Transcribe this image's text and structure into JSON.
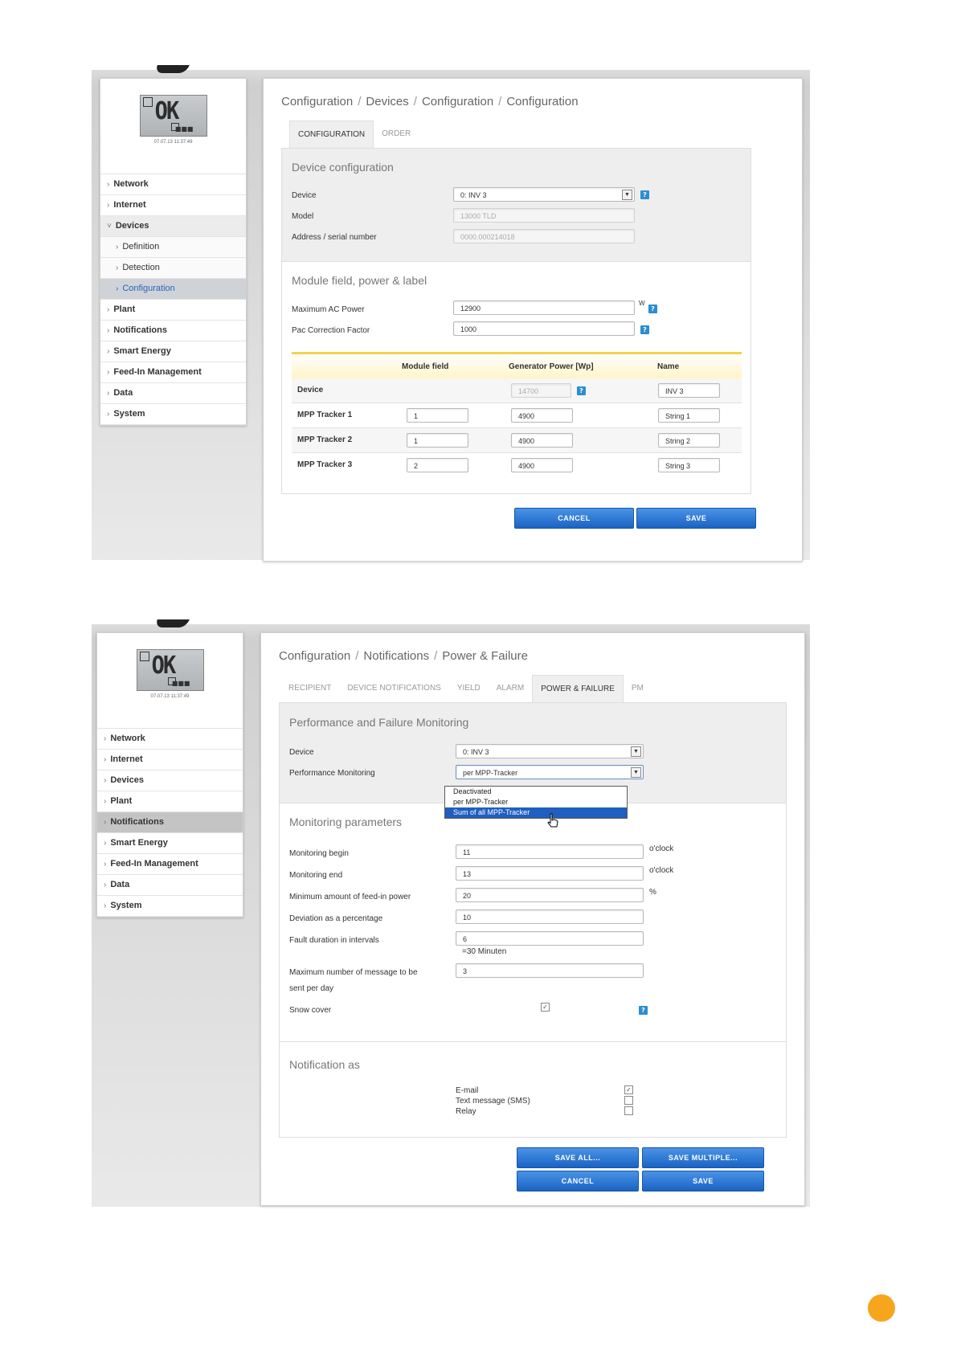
{
  "shot1": {
    "lcd": {
      "text": "OK",
      "time": "07.07.13 11:37:49"
    },
    "sidebar": [
      {
        "label": "Network",
        "type": "item"
      },
      {
        "label": "Internet",
        "type": "item"
      },
      {
        "label": "Devices",
        "type": "open"
      },
      {
        "label": "Definition",
        "type": "sub"
      },
      {
        "label": "Detection",
        "type": "sub"
      },
      {
        "label": "Configuration",
        "type": "sub-active"
      },
      {
        "label": "Plant",
        "type": "item"
      },
      {
        "label": "Notifications",
        "type": "item"
      },
      {
        "label": "Smart Energy",
        "type": "item"
      },
      {
        "label": "Feed-In Management",
        "type": "item"
      },
      {
        "label": "Data",
        "type": "item"
      },
      {
        "label": "System",
        "type": "item"
      }
    ],
    "breadcrumb": [
      "Configuration",
      "Devices",
      "Configuration",
      "Configuration"
    ],
    "tabs": [
      {
        "label": "CONFIGURATION",
        "active": true
      },
      {
        "label": "ORDER",
        "active": false
      }
    ],
    "device_config": {
      "title": "Device configuration",
      "device_label": "Device",
      "device_value": "0: INV 3",
      "model_label": "Model",
      "model_value": "13000 TLD",
      "address_label": "Address / serial number",
      "address_value": "0000.000214018"
    },
    "module": {
      "title": "Module field, power & label",
      "max_ac_label": "Maximum AC Power",
      "max_ac_value": "12900",
      "max_ac_unit": "W",
      "pac_label": "Pac Correction Factor",
      "pac_value": "1000",
      "headers": [
        "Module field",
        "Generator Power [Wp]",
        "Name"
      ],
      "rows": [
        {
          "label": "Device",
          "field": "",
          "power": "14700",
          "name": "INV 3"
        },
        {
          "label": "MPP Tracker 1",
          "field": "1",
          "power": "4900",
          "name": "String 1"
        },
        {
          "label": "MPP Tracker 2",
          "field": "1",
          "power": "4900",
          "name": "String 2"
        },
        {
          "label": "MPP Tracker 3",
          "field": "2",
          "power": "4900",
          "name": "String 3"
        }
      ]
    },
    "buttons": {
      "cancel": "CANCEL",
      "save": "SAVE"
    }
  },
  "shot2": {
    "lcd": {
      "text": "OK",
      "time": "07.07.13 11:37:49"
    },
    "sidebar": [
      {
        "label": "Network",
        "type": "item"
      },
      {
        "label": "Internet",
        "type": "item"
      },
      {
        "label": "Devices",
        "type": "item"
      },
      {
        "label": "Plant",
        "type": "item"
      },
      {
        "label": "Notifications",
        "type": "active"
      },
      {
        "label": "Smart Energy",
        "type": "item"
      },
      {
        "label": "Feed-In Management",
        "type": "item"
      },
      {
        "label": "Data",
        "type": "item"
      },
      {
        "label": "System",
        "type": "item"
      }
    ],
    "breadcrumb": [
      "Configuration",
      "Notifications",
      "Power & Failure"
    ],
    "tabs": [
      {
        "label": "RECIPIENT",
        "active": false
      },
      {
        "label": "DEVICE NOTIFICATIONS",
        "active": false
      },
      {
        "label": "YIELD",
        "active": false
      },
      {
        "label": "ALARM",
        "active": false
      },
      {
        "label": "POWER & FAILURE",
        "active": true
      },
      {
        "label": "PM",
        "active": false
      }
    ],
    "perf": {
      "title": "Performance and Failure Monitoring",
      "device_label": "Device",
      "device_value": "0: INV 3",
      "pm_label": "Performance Monitoring",
      "pm_value": "per MPP-Tracker",
      "options": [
        "Deactivated",
        "per MPP-Tracker",
        "Sum of all MPP-Tracker"
      ],
      "highlighted_option": 2
    },
    "params": {
      "title": "Monitoring parameters",
      "begin_label": "Monitoring begin",
      "begin_value": "11",
      "begin_unit": "o'clock",
      "end_label": "Monitoring end",
      "end_value": "13",
      "end_unit": "o'clock",
      "min_label": "Minimum amount of feed-in power",
      "min_value": "20",
      "min_unit": "%",
      "dev_label": "Deviation as a percentage",
      "dev_value": "10",
      "fault_label": "Fault duration in intervals",
      "fault_value": "6",
      "fault_note": "=30 Minuten",
      "max_label_1": "Maximum number of message to be",
      "max_label_2": "sent per day",
      "max_value": "3",
      "snow_label": "Snow cover",
      "snow_checked": true
    },
    "notify": {
      "title": "Notification as",
      "options": [
        {
          "label": "E-mail",
          "checked": true
        },
        {
          "label": "Text message (SMS)",
          "checked": false
        },
        {
          "label": "Relay",
          "checked": false
        }
      ]
    },
    "buttons": {
      "save_all": "SAVE ALL...",
      "save_multiple": "SAVE MULTIPLE...",
      "cancel": "CANCEL",
      "save": "SAVE"
    }
  },
  "colors": {
    "accent_button": "#2f7fd8",
    "highlight_option": "#1f5fc0",
    "help_icon": "#2b8ed0",
    "table_header_accent": "#f4d24a",
    "page_dot": "#f6a51d"
  }
}
